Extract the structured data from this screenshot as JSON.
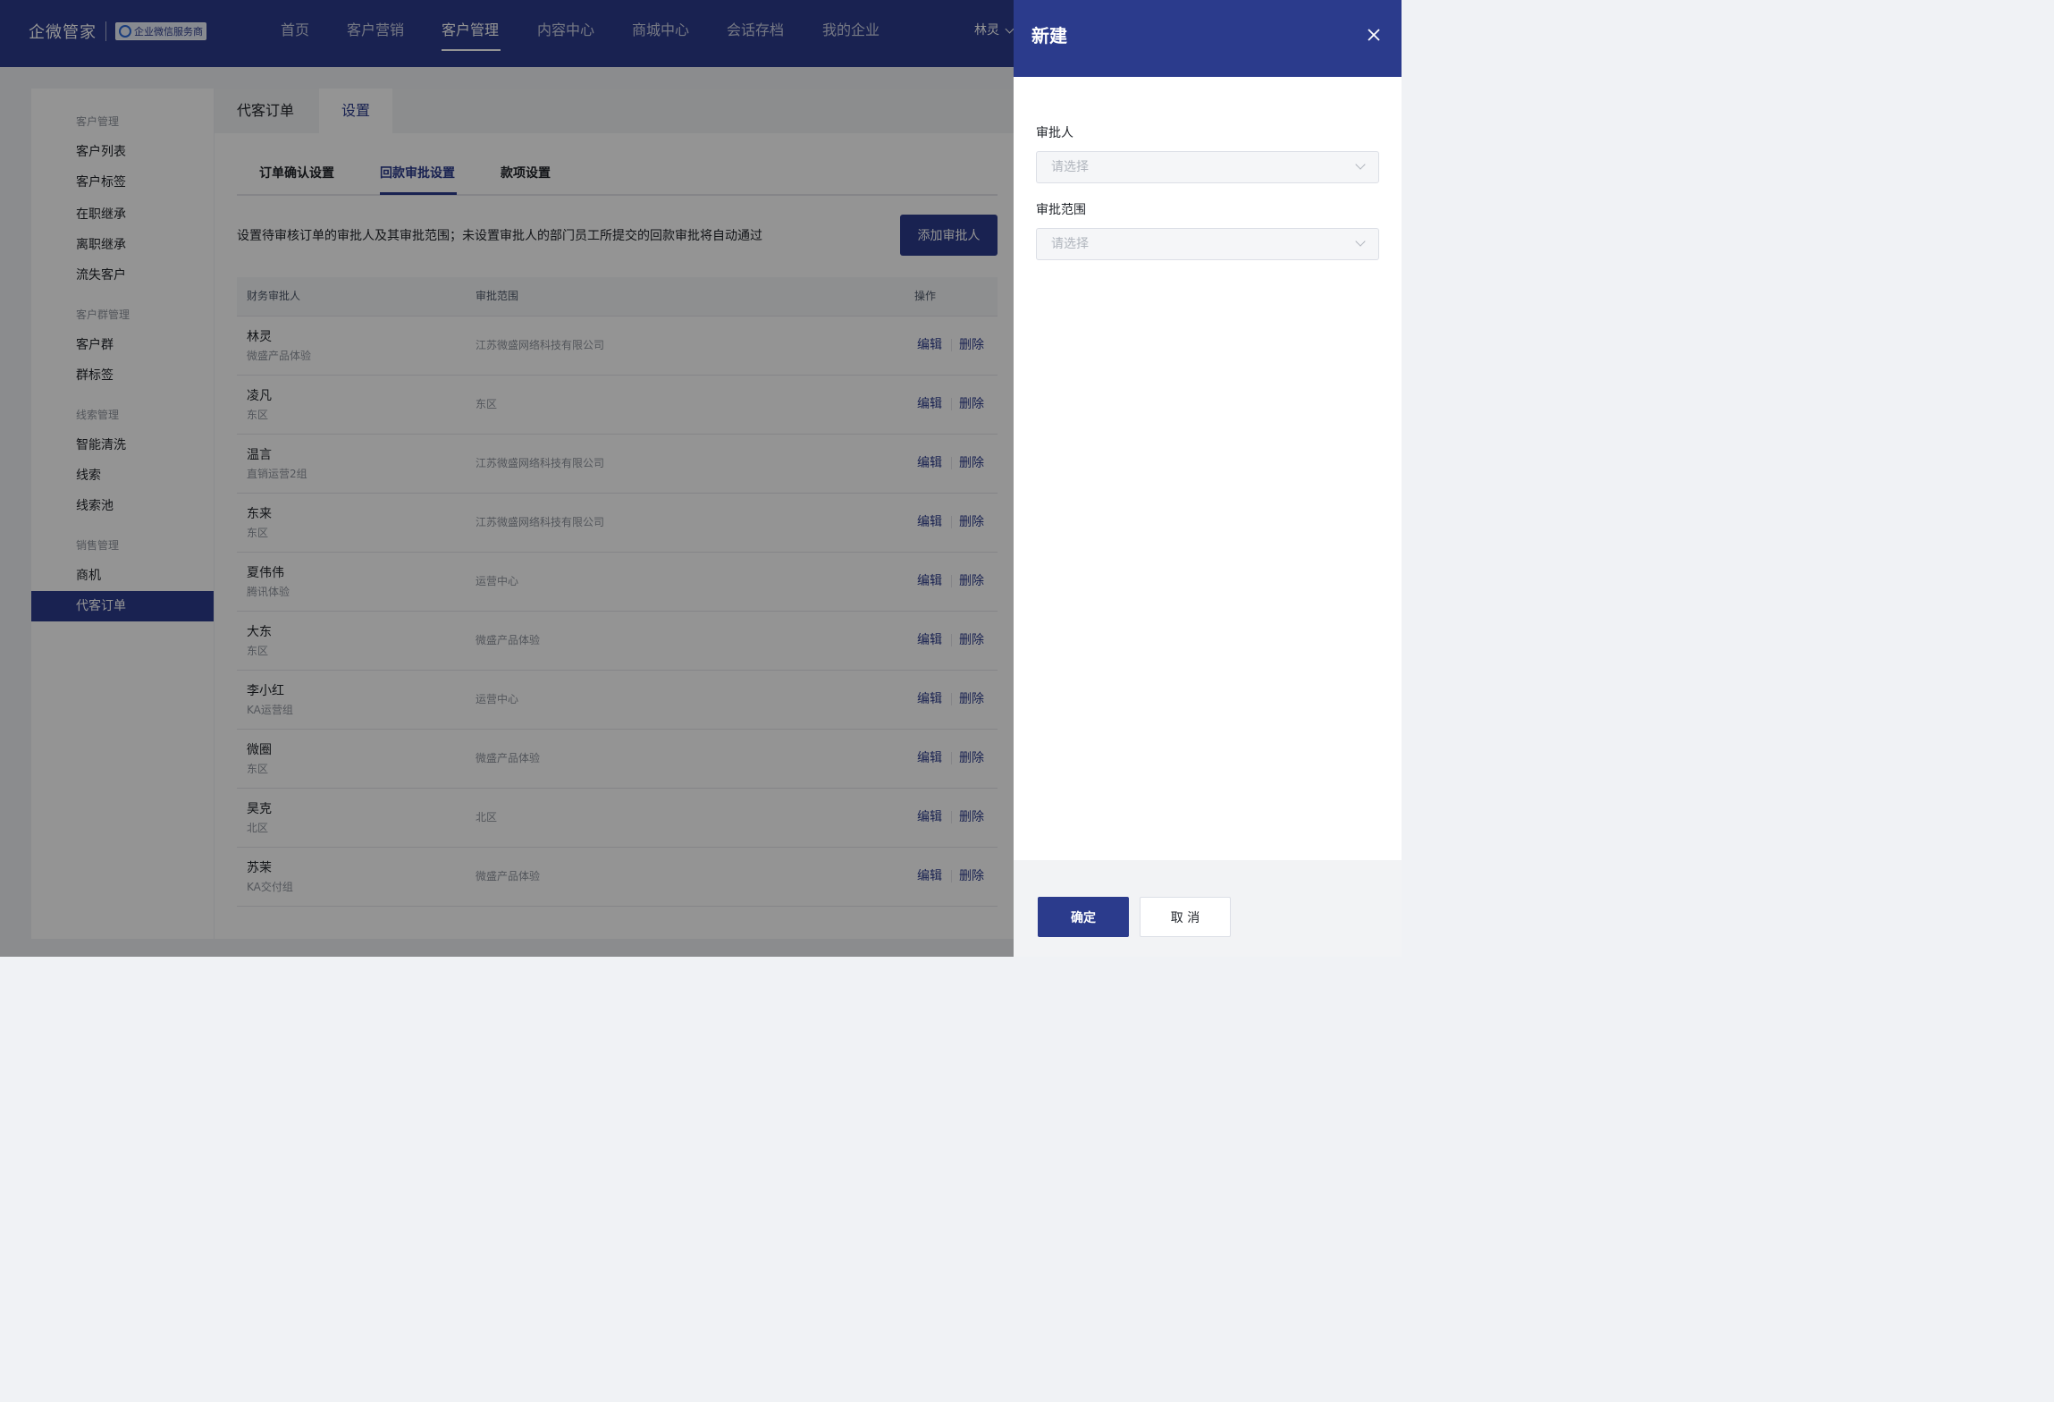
{
  "header": {
    "brand_name": "企微管家",
    "brand_badge": "企业微信服务商",
    "nav": [
      "首页",
      "客户营销",
      "客户管理",
      "内容中心",
      "商城中心",
      "会话存档",
      "我的企业"
    ],
    "active_nav": "客户管理",
    "user_name": "林灵"
  },
  "sidebar": {
    "groups": [
      {
        "title": "客户管理",
        "items": [
          "客户列表",
          "客户标签",
          "在职继承",
          "离职继承",
          "流失客户"
        ]
      },
      {
        "title": "客户群管理",
        "items": [
          "客户群",
          "群标签"
        ]
      },
      {
        "title": "线索管理",
        "items": [
          "智能清洗",
          "线索",
          "线索池"
        ]
      },
      {
        "title": "销售管理",
        "items": [
          "商机",
          "代客订单"
        ]
      }
    ],
    "active_item": "代客订单"
  },
  "main": {
    "tabs": [
      "代客订单",
      "设置"
    ],
    "active_tab": "设置",
    "sub_tabs": [
      "订单确认设置",
      "回款审批设置",
      "款项设置"
    ],
    "active_sub_tab": "回款审批设置",
    "description": "设置待审核订单的审批人及其审批范围；未设置审批人的部门员工所提交的回款审批将自动通过",
    "add_button": "添加审批人",
    "table": {
      "columns": [
        "财务审批人",
        "审批范围",
        "操作"
      ],
      "rows": [
        {
          "name": "林灵",
          "dept": "微盛产品体验",
          "scope": "江苏微盛网络科技有限公司",
          "edit": "编辑",
          "delete": "删除"
        },
        {
          "name": "凌凡",
          "dept": "东区",
          "scope": "东区",
          "edit": "编辑",
          "delete": "删除"
        },
        {
          "name": "温言",
          "dept": "直销运营2组",
          "scope": "江苏微盛网络科技有限公司",
          "edit": "编辑",
          "delete": "删除"
        },
        {
          "name": "东来",
          "dept": "东区",
          "scope": "江苏微盛网络科技有限公司",
          "edit": "编辑",
          "delete": "删除"
        },
        {
          "name": "夏伟伟",
          "dept": "腾讯体验",
          "scope": "运营中心",
          "edit": "编辑",
          "delete": "删除"
        },
        {
          "name": "大东",
          "dept": "东区",
          "scope": "微盛产品体验",
          "edit": "编辑",
          "delete": "删除"
        },
        {
          "name": "李小红",
          "dept": "KA运营组",
          "scope": "运营中心",
          "edit": "编辑",
          "delete": "删除"
        },
        {
          "name": "微圈",
          "dept": "东区",
          "scope": "微盛产品体验",
          "edit": "编辑",
          "delete": "删除"
        },
        {
          "name": "昊克",
          "dept": "北区",
          "scope": "北区",
          "edit": "编辑",
          "delete": "删除"
        },
        {
          "name": "苏茉",
          "dept": "KA交付组",
          "scope": "微盛产品体验",
          "edit": "编辑",
          "delete": "删除"
        }
      ]
    }
  },
  "drawer": {
    "title": "新建",
    "close_icon": "close-icon",
    "fields": [
      {
        "label": "审批人",
        "placeholder": "请选择"
      },
      {
        "label": "审批范围",
        "placeholder": "请选择"
      }
    ],
    "ok_label": "确定",
    "cancel_label": "取 消"
  },
  "colors": {
    "primary": "#2b3b8c",
    "page_bg": "#f0f2f5",
    "mask": "rgba(0,0,0,0.42)",
    "muted_text": "#8f959e"
  }
}
